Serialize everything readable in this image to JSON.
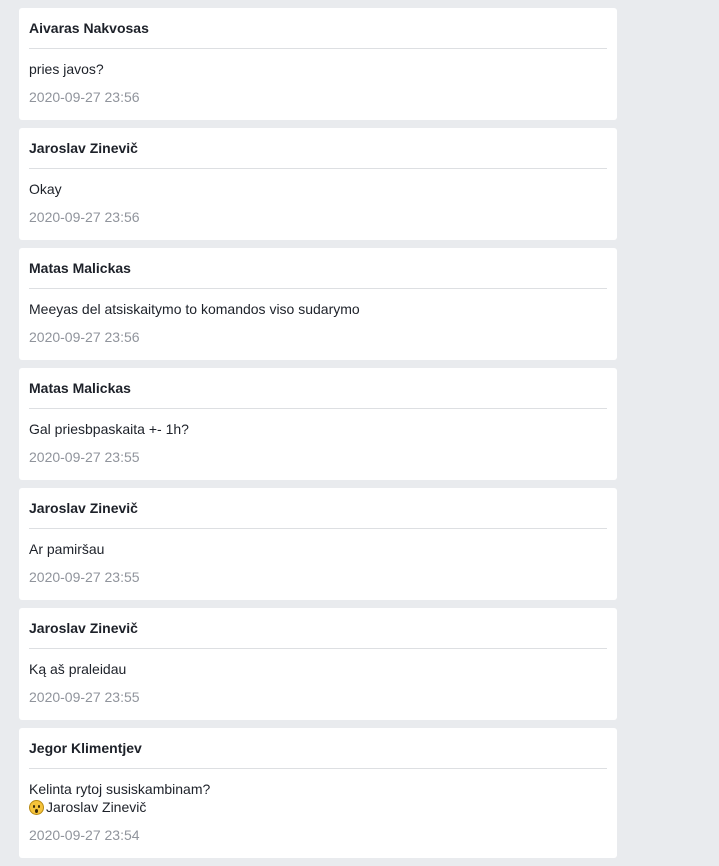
{
  "messages": [
    {
      "author": "Aivaras Nakvosas",
      "text": "pries javos?",
      "time": "2020-09-27 23:56"
    },
    {
      "author": "Jaroslav Zinevič",
      "text": "Okay",
      "time": "2020-09-27 23:56"
    },
    {
      "author": "Matas Malickas",
      "text": "Meeyas del atsiskaitymo to komandos viso sudarymo",
      "time": "2020-09-27 23:56"
    },
    {
      "author": "Matas Malickas",
      "text": "Gal priesbpaskaita +- 1h?",
      "time": "2020-09-27 23:55"
    },
    {
      "author": "Jaroslav Zinevič",
      "text": "Ar pamiršau",
      "time": "2020-09-27 23:55"
    },
    {
      "author": "Jaroslav Zinevič",
      "text": "Ką aš praleidau",
      "time": "2020-09-27 23:55"
    },
    {
      "author": "Jegor Klimentjev",
      "text": "Kelinta rytoj susiskambinam?",
      "reaction_icon": "surprised-face-icon",
      "mention": "Jaroslav Zinevič",
      "time": "2020-09-27 23:54"
    }
  ]
}
